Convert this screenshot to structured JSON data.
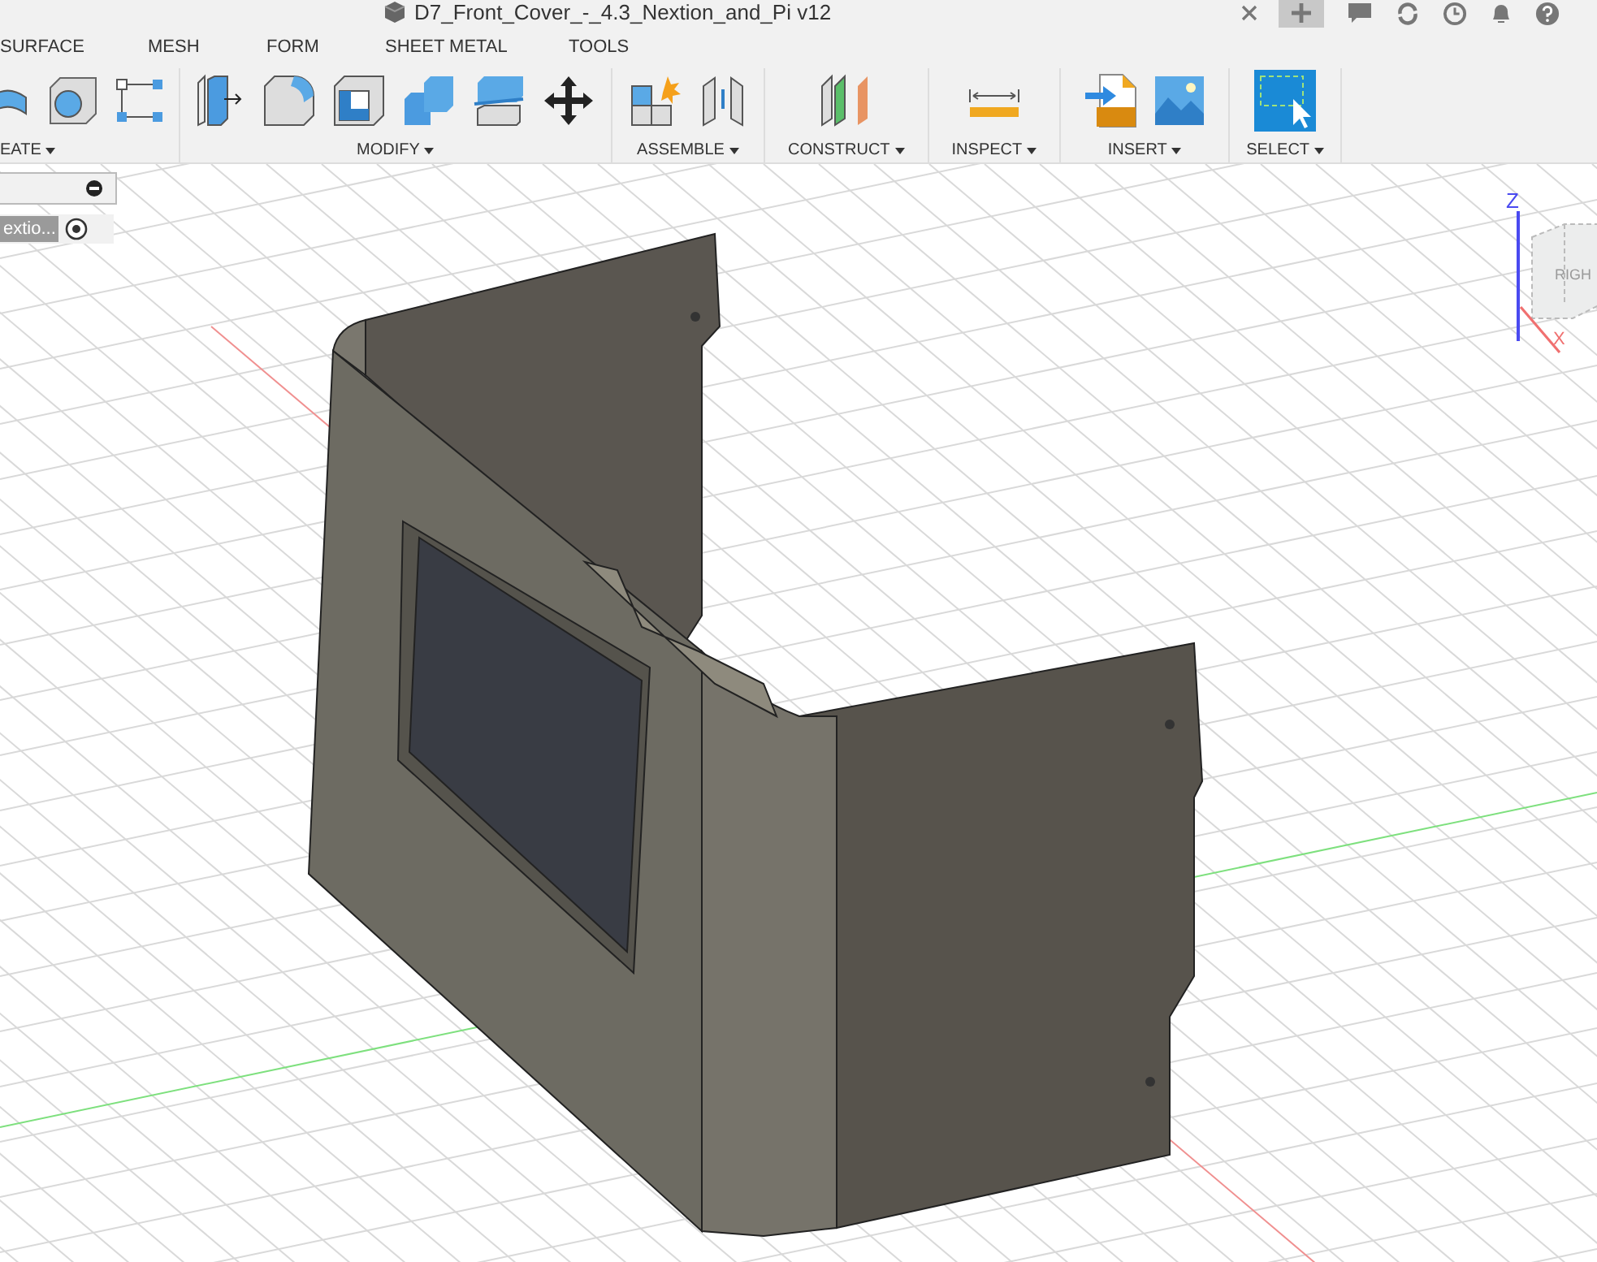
{
  "window": {
    "title": "D7_Front_Cover_-_4.3_Nextion_and_Pi v12"
  },
  "tabs": [
    {
      "label": "SURFACE"
    },
    {
      "label": "MESH"
    },
    {
      "label": "FORM"
    },
    {
      "label": "SHEET METAL"
    },
    {
      "label": "TOOLS"
    }
  ],
  "toolbar_groups": [
    {
      "label": "EATE"
    },
    {
      "label": "MODIFY"
    },
    {
      "label": "ASSEMBLE"
    },
    {
      "label": "CONSTRUCT"
    },
    {
      "label": "INSPECT"
    },
    {
      "label": "INSERT"
    },
    {
      "label": "SELECT"
    }
  ],
  "browser": {
    "item": {
      "label": "extio...",
      "selected": true
    }
  },
  "viewcube": {
    "axis_z": "Z",
    "axis_x": "X",
    "face": "RIGH"
  }
}
